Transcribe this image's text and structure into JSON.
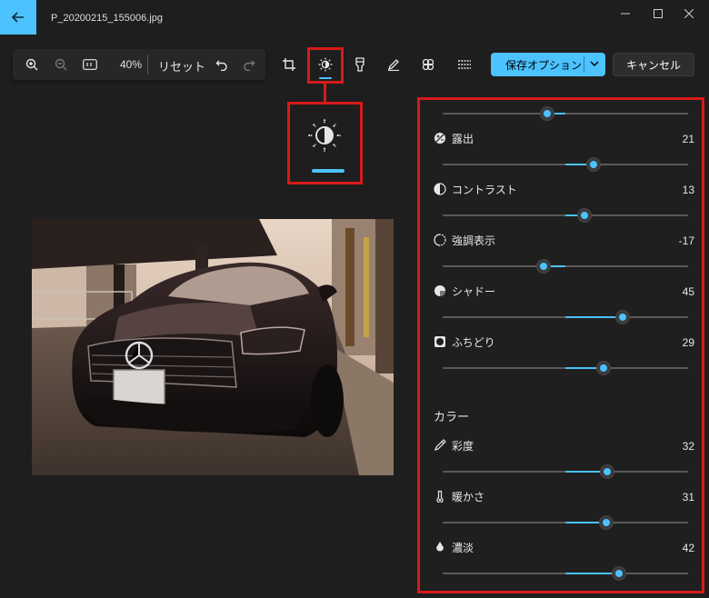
{
  "window": {
    "title": "P_20200215_155006.jpg"
  },
  "toolbar": {
    "zoom": "40%",
    "reset_label": "リセット"
  },
  "actions": {
    "save_label": "保存オプション",
    "cancel_label": "キャンセル"
  },
  "colors": {
    "accent": "#4cc2ff",
    "highlight": "#d71a1a"
  },
  "adjust": {
    "top_slider": {
      "value": -17
    },
    "rows": [
      {
        "label": "露出",
        "value": "21",
        "icon": "exposure-icon"
      },
      {
        "label": "コントラスト",
        "value": "13",
        "icon": "contrast-icon"
      },
      {
        "label": "強調表示",
        "value": "-17",
        "icon": "highlights-icon"
      },
      {
        "label": "シャドー",
        "value": "45",
        "icon": "shadows-icon"
      },
      {
        "label": "ふちどり",
        "value": "29",
        "icon": "vignette-icon"
      }
    ],
    "color_section_title": "カラー",
    "color_rows": [
      {
        "label": "彩度",
        "value": "32",
        "icon": "saturation-icon"
      },
      {
        "label": "暖かさ",
        "value": "31",
        "icon": "warmth-icon"
      },
      {
        "label": "濃淡",
        "value": "42",
        "icon": "tint-icon"
      }
    ]
  }
}
